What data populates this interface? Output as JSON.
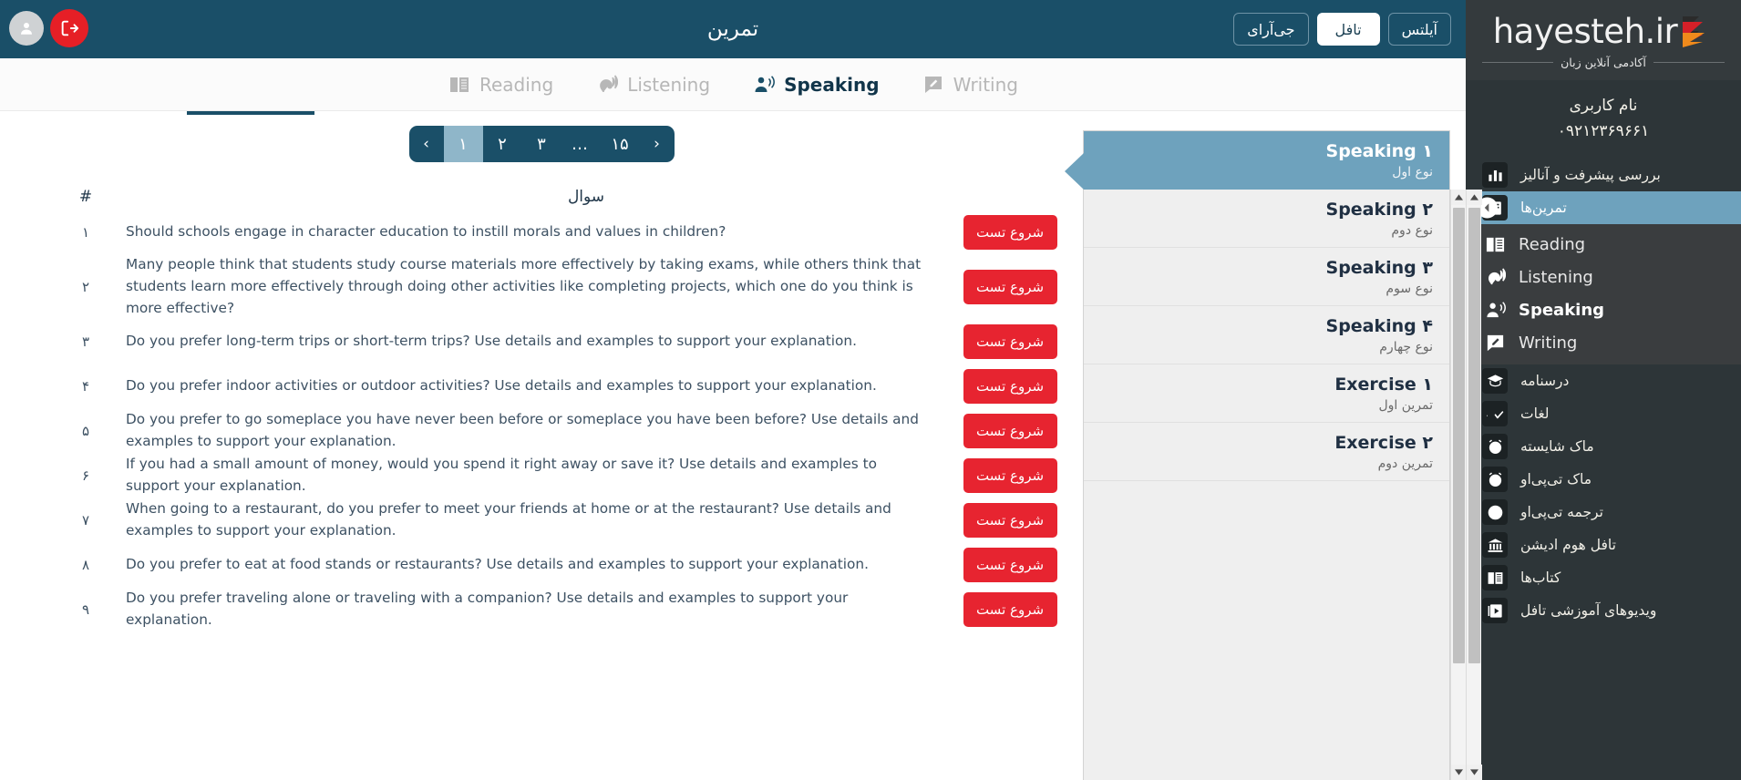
{
  "topbar": {
    "title": "تمرین",
    "logout_label": "خروج",
    "avatar_label": "پروفایل",
    "exam_buttons": [
      {
        "label": "آیلتس",
        "active": false
      },
      {
        "label": "تافل",
        "active": true
      },
      {
        "label": "جی‌آرای",
        "active": false
      }
    ],
    "bg_color": "#1a4f68"
  },
  "tabs": [
    {
      "label": "Writing",
      "icon": "writing-icon",
      "active": false
    },
    {
      "label": "Speaking",
      "icon": "speaking-icon",
      "active": true
    },
    {
      "label": "Listening",
      "icon": "listening-icon",
      "active": false
    },
    {
      "label": "Reading",
      "icon": "reading-icon",
      "active": false
    }
  ],
  "pagination": {
    "prev": "‹",
    "next": "›",
    "pages": [
      "۱",
      "۲",
      "۳",
      "…",
      "۱۵"
    ],
    "current": "۱"
  },
  "table": {
    "header_question": "سوال",
    "header_number": "#",
    "start_button_label": "شروع تست",
    "rows": [
      {
        "num": "۱",
        "text": "Should schools engage in character education to instill morals and values in children?"
      },
      {
        "num": "۲",
        "text": "Many people think that students study course materials more effectively by taking exams, while others think that students learn more effectively through doing other activities like completing projects, which one do you think is more effective?"
      },
      {
        "num": "۳",
        "text": "Do you prefer long-term trips or short-term trips? Use details and examples to support your explanation."
      },
      {
        "num": "۴",
        "text": "Do you prefer indoor activities or outdoor activities? Use details and examples to support your explanation."
      },
      {
        "num": "۵",
        "text": "Do you prefer to go someplace you have never been before or someplace you have been before? Use details and examples to support your explanation."
      },
      {
        "num": "۶",
        "text": "If you had a small amount of money, would you spend it right away or save it? Use details and examples to support your explanation."
      },
      {
        "num": "۷",
        "text": "When going to a restaurant, do you prefer to meet your friends at home or at the restaurant? Use details and examples to support your explanation."
      },
      {
        "num": "۸",
        "text": "Do you prefer to eat at food stands or restaurants? Use details and examples to support your explanation."
      },
      {
        "num": "۹",
        "text": "Do you prefer traveling alone or traveling with a companion? Use details and examples to support your explanation."
      }
    ]
  },
  "exercise_list": [
    {
      "title": "Speaking ۱",
      "subtitle": "نوع اول",
      "active": true
    },
    {
      "title": "Speaking ۲",
      "subtitle": "نوع دوم",
      "active": false
    },
    {
      "title": "Speaking ۳",
      "subtitle": "نوع سوم",
      "active": false
    },
    {
      "title": "Speaking ۴",
      "subtitle": "نوع چهارم",
      "active": false
    },
    {
      "title": "Exercise ۱",
      "subtitle": "تمرین اول",
      "active": false
    },
    {
      "title": "Exercise ۲",
      "subtitle": "تمرین دوم",
      "active": false
    }
  ],
  "sidebar": {
    "logo_text": "hayesteh.ir",
    "logo_tagline": "آکادمی آنلاین زبان",
    "user_label": "نام کاربری",
    "user_phone": "۰۹۲۱۲۳۶۹۶۶۱",
    "nav": [
      {
        "label": "بررسی پیشرفت و آنالیز",
        "icon": "chart-icon",
        "active": false
      },
      {
        "label": "تمرین‌ها",
        "icon": "exercises-icon",
        "active": true
      }
    ],
    "subnav": [
      {
        "label": "Reading",
        "icon": "reading-icon",
        "active": false
      },
      {
        "label": "Listening",
        "icon": "listening-icon",
        "active": false
      },
      {
        "label": "Speaking",
        "icon": "speaking-icon",
        "active": true
      },
      {
        "label": "Writing",
        "icon": "writing-icon",
        "active": false
      }
    ],
    "nav_bottom": [
      {
        "label": "درسنامه",
        "icon": "graduation-cap-icon"
      },
      {
        "label": "لغات",
        "icon": "vocabulary-check-icon"
      },
      {
        "label": "ماک شایسته",
        "icon": "alarm-clock-icon"
      },
      {
        "label": "ماک تی‌پی‌او",
        "icon": "alarm-clock-icon"
      },
      {
        "label": "ترجمه تی‌پی‌او",
        "icon": "globe-icon"
      },
      {
        "label": "تافل هوم ادیشن",
        "icon": "bank-icon"
      },
      {
        "label": "کتاب‌ها",
        "icon": "book-icon"
      },
      {
        "label": "ویدیوهای آموزشی تافل",
        "icon": "video-icon"
      }
    ]
  },
  "colors": {
    "primary": "#1a4f68",
    "accent_red": "#e72430",
    "highlight_blue": "#6ea2bd",
    "sidebar_dark": "#2d3538"
  }
}
